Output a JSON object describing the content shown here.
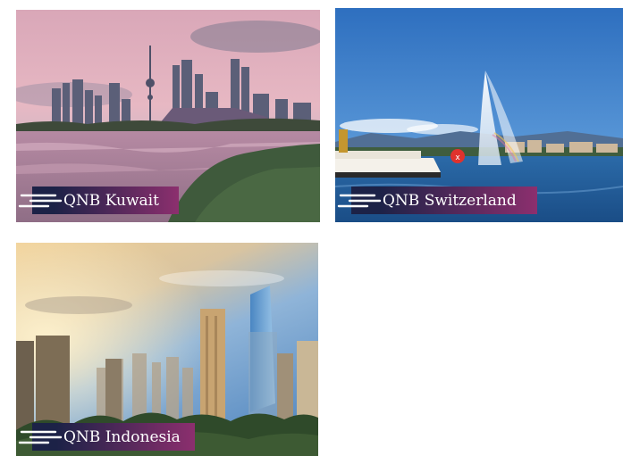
{
  "colors": {
    "tag_start": "#1c2247",
    "tag_end": "#8c2f6e",
    "tag_text": "#ffffff",
    "dash": "#ffffff"
  },
  "cards": [
    {
      "name": "kuwait",
      "label": "QNB Kuwait",
      "icon": "speed-lines-icon"
    },
    {
      "name": "switzerland",
      "label": "QNB Switzerland",
      "icon": "speed-lines-icon"
    },
    {
      "name": "indonesia",
      "label": "QNB Indonesia",
      "icon": "speed-lines-icon"
    }
  ]
}
